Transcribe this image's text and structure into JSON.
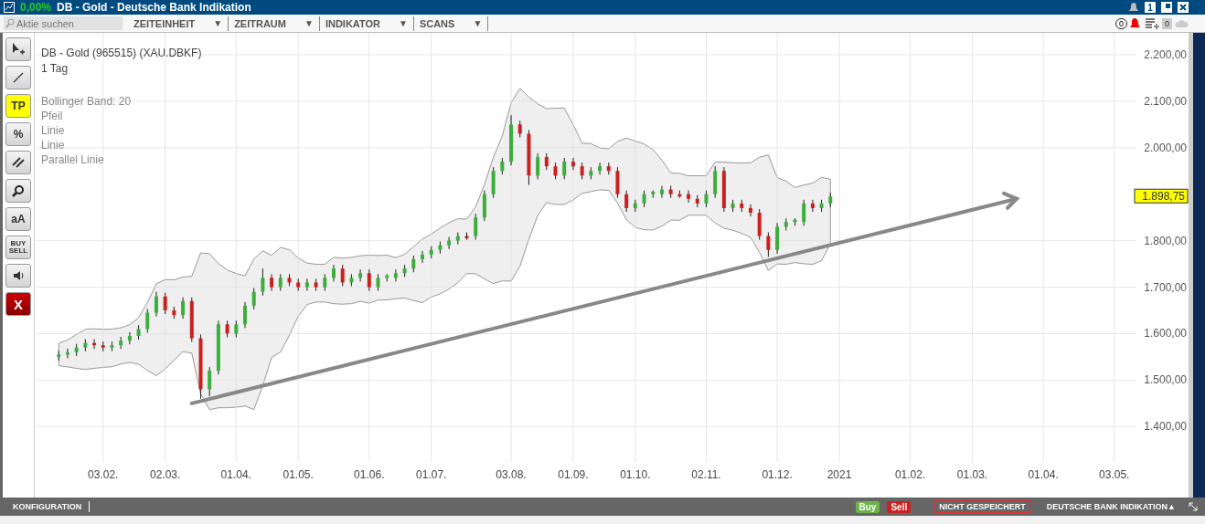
{
  "window": {
    "change": "0,00%",
    "title": "DB - Gold - Deutsche Bank Indikation",
    "page_badge": "1"
  },
  "toolbar": {
    "search": {
      "placeholder": "Aktie suchen"
    },
    "menus": [
      {
        "label": "ZEITEINHEIT",
        "caret": "▼"
      },
      {
        "label": "ZEITRAUM",
        "caret": "▼"
      },
      {
        "label": "INDIKATOR",
        "caret": "▼"
      },
      {
        "label": "SCANS",
        "caret": "▼"
      }
    ],
    "alert_count": "0",
    "list_count": "0"
  },
  "tools": [
    {
      "kind": "cursor",
      "active": false
    },
    {
      "kind": "line",
      "active": false
    },
    {
      "kind": "text",
      "label": "TP",
      "active": true
    },
    {
      "kind": "percent",
      "label": "%",
      "active": false
    },
    {
      "kind": "parallel",
      "active": false
    },
    {
      "kind": "zoom",
      "active": false
    },
    {
      "kind": "text",
      "label": "aA",
      "active": false
    },
    {
      "kind": "buysell",
      "lines": [
        "BUY",
        "SELL"
      ],
      "active": false
    },
    {
      "kind": "sound",
      "active": false
    },
    {
      "kind": "delete",
      "label": "X",
      "active": false
    }
  ],
  "chart": {
    "instrument": "DB - Gold (965515) (XAU.DBKF)",
    "period": "1 Tag",
    "overlays": [
      "Bollinger Band: 20",
      "Pfeil",
      "Linie",
      "Linie",
      "Parallel Linie"
    ],
    "last_price": "1.898,75",
    "chart_data": {
      "type": "candlestick",
      "grid": true,
      "ylim": [
        1324,
        2247
      ],
      "yticks": [
        {
          "value": 2200,
          "label": "2.200,00"
        },
        {
          "value": 2100,
          "label": "2.100,00"
        },
        {
          "value": 2000,
          "label": "2.000,00"
        },
        {
          "value": 1800,
          "label": "1.800,00"
        },
        {
          "value": 1700,
          "label": "1.700,00"
        },
        {
          "value": 1600,
          "label": "1.600,00"
        },
        {
          "value": 1500,
          "label": "1.500,00"
        },
        {
          "value": 1400,
          "label": "1.400,00"
        }
      ],
      "categories": [
        null,
        null,
        null,
        null,
        null,
        null,
        null,
        "03.02.",
        null,
        null,
        null,
        null,
        null,
        null,
        "02.03.",
        null,
        null,
        null,
        null,
        null,
        null,
        null,
        "01.04.",
        null,
        null,
        null,
        null,
        null,
        null,
        "01.05.",
        null,
        null,
        null,
        null,
        null,
        null,
        null,
        "01.06.",
        null,
        null,
        null,
        null,
        null,
        null,
        "01.07.",
        null,
        null,
        null,
        null,
        null,
        null,
        null,
        null,
        "03.08.",
        null,
        null,
        null,
        null,
        null,
        null,
        "01.09.",
        null,
        null,
        null,
        null,
        null,
        null,
        "01.10.",
        null,
        null,
        null,
        null,
        null,
        null,
        null,
        "02.11.",
        null,
        null,
        null,
        null,
        null,
        null,
        null,
        "01.12.",
        null,
        null,
        null,
        null,
        null,
        null,
        "2021",
        null,
        null,
        null,
        null,
        null,
        null,
        null,
        "01.02.",
        null,
        null,
        null,
        null,
        null,
        null,
        "01.03.",
        null,
        null,
        null,
        null,
        null,
        null,
        null,
        "01.04.",
        null,
        null,
        null,
        null,
        null,
        null,
        null,
        "03.05.",
        null,
        null
      ],
      "ohlc": [
        null,
        null,
        [
          1550,
          1563,
          1542,
          1555
        ],
        [
          1555,
          1568,
          1547,
          1560
        ],
        [
          1560,
          1578,
          1552,
          1570
        ],
        [
          1570,
          1588,
          1562,
          1580
        ],
        [
          1580,
          1588,
          1567,
          1575
        ],
        [
          1575,
          1583,
          1562,
          1570
        ],
        [
          1570,
          1583,
          1562,
          1575
        ],
        [
          1575,
          1593,
          1567,
          1585
        ],
        [
          1585,
          1603,
          1577,
          1595
        ],
        [
          1595,
          1618,
          1587,
          1610
        ],
        [
          1610,
          1653,
          1602,
          1645
        ],
        [
          1645,
          1690,
          1637,
          1680
        ],
        [
          1680,
          1688,
          1642,
          1650
        ],
        [
          1650,
          1658,
          1632,
          1640
        ],
        [
          1640,
          1678,
          1632,
          1670
        ],
        [
          1670,
          1678,
          1582,
          1590
        ],
        [
          1590,
          1598,
          1460,
          1480
        ],
        [
          1480,
          1528,
          1465,
          1520
        ],
        [
          1520,
          1628,
          1512,
          1620
        ],
        [
          1620,
          1628,
          1592,
          1600
        ],
        [
          1600,
          1628,
          1592,
          1620
        ],
        [
          1620,
          1668,
          1612,
          1660
        ],
        [
          1660,
          1698,
          1652,
          1690
        ],
        [
          1690,
          1740,
          1682,
          1720
        ],
        [
          1720,
          1728,
          1692,
          1700
        ],
        [
          1700,
          1728,
          1692,
          1720
        ],
        [
          1720,
          1728,
          1702,
          1710
        ],
        [
          1710,
          1718,
          1692,
          1700
        ],
        [
          1700,
          1718,
          1692,
          1710
        ],
        [
          1710,
          1718,
          1692,
          1700
        ],
        [
          1700,
          1728,
          1692,
          1720
        ],
        [
          1720,
          1748,
          1712,
          1740
        ],
        [
          1740,
          1748,
          1702,
          1710
        ],
        [
          1710,
          1728,
          1702,
          1720
        ],
        [
          1720,
          1738,
          1712,
          1730
        ],
        [
          1730,
          1738,
          1692,
          1700
        ],
        [
          1700,
          1728,
          1692,
          1720
        ],
        [
          1720,
          1728,
          1712,
          1725
        ],
        [
          1720,
          1738,
          1712,
          1730
        ],
        [
          1730,
          1748,
          1722,
          1740
        ],
        [
          1740,
          1768,
          1732,
          1760
        ],
        [
          1760,
          1778,
          1752,
          1770
        ],
        [
          1770,
          1788,
          1762,
          1780
        ],
        [
          1780,
          1798,
          1772,
          1790
        ],
        [
          1790,
          1808,
          1782,
          1800
        ],
        [
          1800,
          1818,
          1792,
          1810
        ],
        [
          1810,
          1818,
          1802,
          1805
        ],
        [
          1810,
          1858,
          1802,
          1850
        ],
        [
          1850,
          1908,
          1842,
          1900
        ],
        [
          1900,
          1958,
          1892,
          1950
        ],
        [
          1950,
          1978,
          1942,
          1970
        ],
        [
          1970,
          2070,
          1962,
          2050
        ],
        [
          2050,
          2058,
          2022,
          2030
        ],
        [
          2030,
          2038,
          1920,
          1940
        ],
        [
          1940,
          1988,
          1932,
          1980
        ],
        [
          1980,
          1988,
          1952,
          1960
        ],
        [
          1960,
          1968,
          1932,
          1940
        ],
        [
          1940,
          1978,
          1932,
          1970
        ],
        [
          1970,
          1978,
          1952,
          1960
        ],
        [
          1960,
          1968,
          1932,
          1940
        ],
        [
          1940,
          1958,
          1932,
          1950
        ],
        [
          1950,
          1968,
          1942,
          1960
        ],
        [
          1960,
          1968,
          1942,
          1950
        ],
        [
          1950,
          1958,
          1892,
          1900
        ],
        [
          1900,
          1908,
          1862,
          1870
        ],
        [
          1870,
          1888,
          1862,
          1880
        ],
        [
          1880,
          1908,
          1872,
          1900
        ],
        [
          1900,
          1908,
          1892,
          1905
        ],
        [
          1900,
          1918,
          1892,
          1910
        ],
        [
          1910,
          1918,
          1892,
          1900
        ],
        [
          1900,
          1908,
          1892,
          1895
        ],
        [
          1900,
          1908,
          1882,
          1890
        ],
        [
          1890,
          1898,
          1872,
          1880
        ],
        [
          1880,
          1908,
          1872,
          1900
        ],
        [
          1900,
          1960,
          1892,
          1950
        ],
        [
          1950,
          1958,
          1862,
          1870
        ],
        [
          1870,
          1888,
          1862,
          1880
        ],
        [
          1880,
          1888,
          1862,
          1870
        ],
        [
          1870,
          1878,
          1852,
          1860
        ],
        [
          1860,
          1868,
          1802,
          1810
        ],
        [
          1810,
          1818,
          1765,
          1780
        ],
        [
          1780,
          1838,
          1772,
          1830
        ],
        [
          1830,
          1848,
          1822,
          1840
        ],
        [
          1840,
          1848,
          1832,
          1845
        ],
        [
          1840,
          1888,
          1832,
          1880
        ],
        [
          1880,
          1888,
          1862,
          1870
        ],
        [
          1870,
          1888,
          1862,
          1880
        ],
        [
          1880,
          1903,
          1872,
          1895
        ],
        null,
        null,
        null,
        null,
        null,
        null,
        null,
        null,
        null,
        null,
        null,
        null,
        null,
        null,
        null,
        null,
        null,
        null,
        null,
        null,
        null,
        null,
        null,
        null,
        null,
        null,
        null,
        null,
        null,
        null,
        null,
        null,
        null,
        null
      ]
    }
  },
  "status_bar": {
    "config": "KONFIGURATION",
    "buy": "Buy",
    "sell": "Sell",
    "save_state": "NICHT GESPEICHERT",
    "source": "DEUTSCHE BANK INDIKATION▲"
  }
}
